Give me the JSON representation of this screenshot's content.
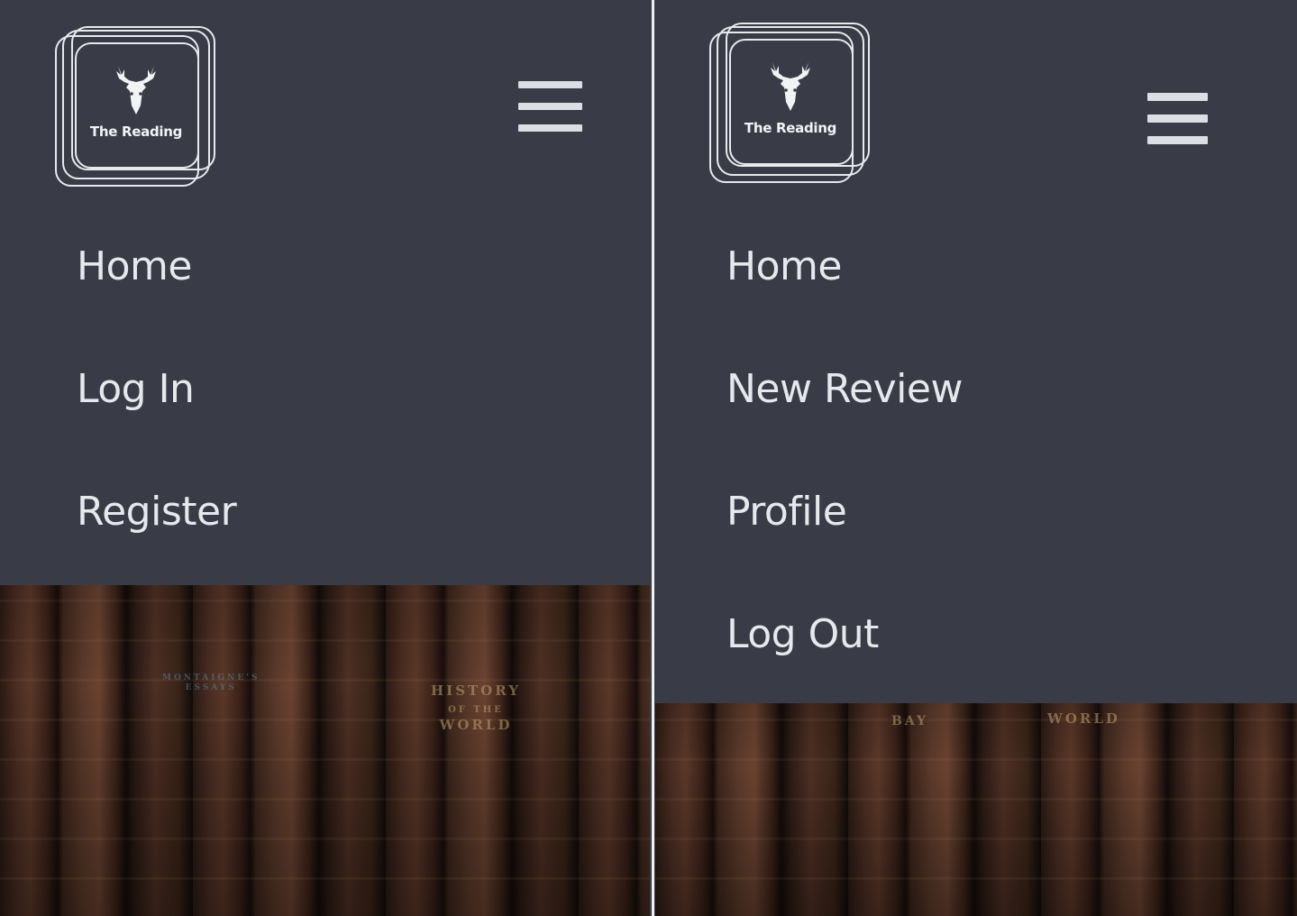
{
  "brand": {
    "logo_text": "The Reading",
    "logo_icon": "deer-head-icon",
    "menu_icon": "hamburger-menu-icon"
  },
  "left_panel": {
    "menu": [
      "Home",
      "Log In",
      "Register"
    ]
  },
  "right_panel": {
    "menu": [
      "Home",
      "New Review",
      "Profile",
      "Log Out"
    ]
  },
  "colors": {
    "nav_background": "#393c46",
    "text": "#e6e8ec"
  }
}
